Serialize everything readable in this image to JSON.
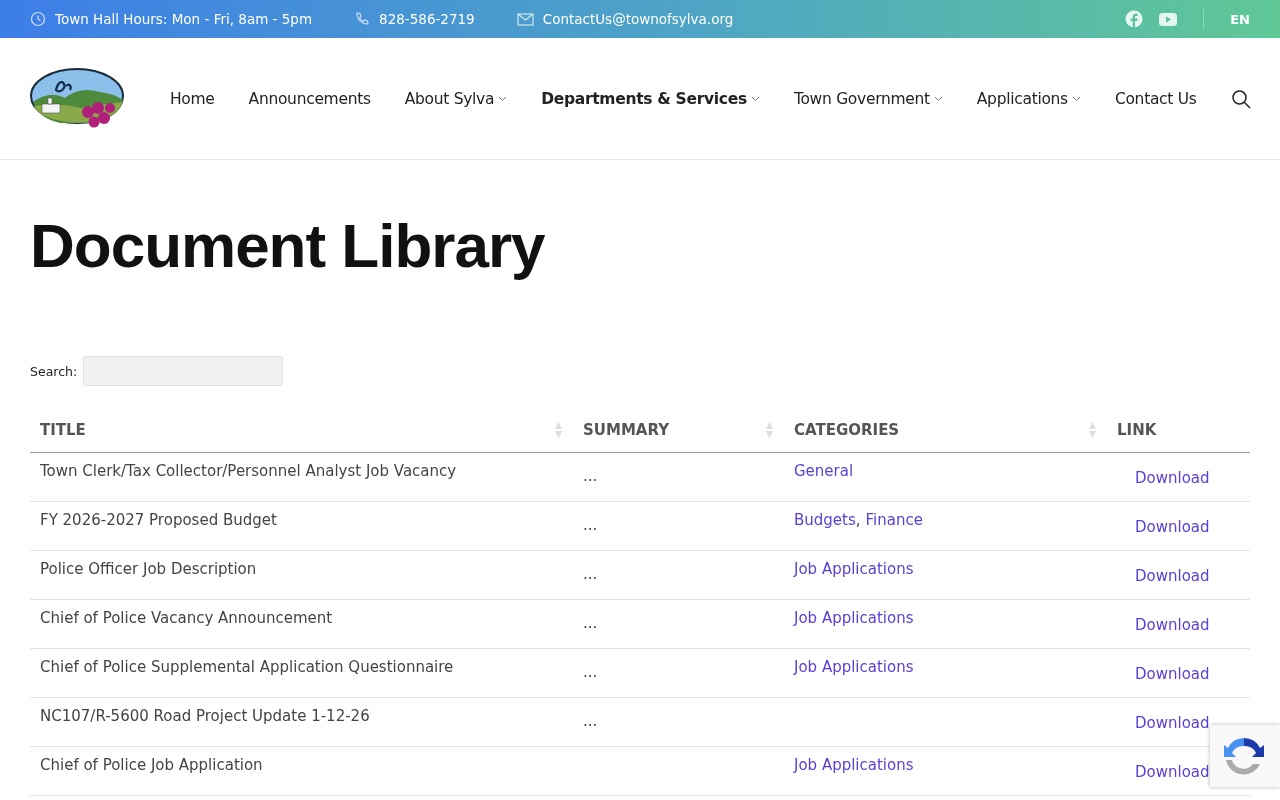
{
  "top_bar": {
    "hours": "Town Hall Hours: Mon - Fri, 8am - 5pm",
    "phone": "828-586-2719",
    "email": "ContactUs@townofsylva.org",
    "language": "EN"
  },
  "nav": {
    "items": [
      {
        "label": "Home",
        "dropdown": false,
        "selected": false
      },
      {
        "label": "Announcements",
        "dropdown": false,
        "selected": false
      },
      {
        "label": "About Sylva",
        "dropdown": true,
        "selected": false
      },
      {
        "label": "Departments & Services",
        "dropdown": true,
        "selected": true
      },
      {
        "label": "Town Government",
        "dropdown": true,
        "selected": false
      },
      {
        "label": "Applications",
        "dropdown": true,
        "selected": false
      },
      {
        "label": "Contact Us",
        "dropdown": false,
        "selected": false
      }
    ]
  },
  "page_title": "Document Library",
  "search": {
    "label": "Search:"
  },
  "table": {
    "separator": ",",
    "columns": [
      {
        "label": "TITLE",
        "sortable": true
      },
      {
        "label": "SUMMARY",
        "sortable": true
      },
      {
        "label": "CATEGORIES",
        "sortable": true
      },
      {
        "label": "LINK",
        "sortable": false
      }
    ],
    "rows": [
      {
        "title": "Town Clerk/Tax Collector/Personnel Analyst Job Vacancy",
        "summary": "...",
        "categories": [
          "General"
        ],
        "link": "Download"
      },
      {
        "title": "FY 2026-2027 Proposed Budget",
        "summary": "...",
        "categories": [
          "Budgets",
          "Finance"
        ],
        "link": "Download"
      },
      {
        "title": "Police Officer Job Description",
        "summary": "...",
        "categories": [
          "Job Applications"
        ],
        "link": "Download"
      },
      {
        "title": "Chief of Police Vacancy Announcement",
        "summary": "...",
        "categories": [
          "Job Applications"
        ],
        "link": "Download"
      },
      {
        "title": "Chief of Police Supplemental Application Questionnaire",
        "summary": "...",
        "categories": [
          "Job Applications"
        ],
        "link": "Download"
      },
      {
        "title": "NC107/R-5600 Road Project Update 1-12-26",
        "summary": "...",
        "categories": [],
        "link": "Download"
      },
      {
        "title": "Chief of Police Job Application",
        "categories": [
          "Job Applications"
        ],
        "link": "Download"
      }
    ]
  }
}
